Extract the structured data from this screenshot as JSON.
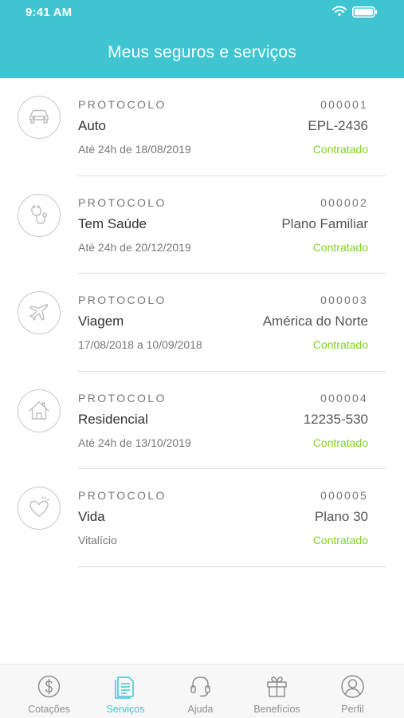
{
  "status_bar": {
    "time": "9:41 AM"
  },
  "header": {
    "title": "Meus seguros e serviços"
  },
  "colors": {
    "accent": "#3ec5d1",
    "status_green": "#7ed321",
    "icon_gray": "#8e8e8e"
  },
  "items": [
    {
      "icon": "car-icon",
      "protocol_label": "PROTOCOLO",
      "protocol_number": "000001",
      "name": "Auto",
      "detail": "EPL-2436",
      "date": "Até 24h de 18/08/2019",
      "status": "Contratado"
    },
    {
      "icon": "stethoscope-icon",
      "protocol_label": "PROTOCOLO",
      "protocol_number": "000002",
      "name": "Tem Saúde",
      "detail": "Plano Familiar",
      "date": "Até 24h de 20/12/2019",
      "status": "Contratado"
    },
    {
      "icon": "airplane-icon",
      "protocol_label": "PROTOCOLO",
      "protocol_number": "000003",
      "name": "Viagem",
      "detail": "América do Norte",
      "date": "17/08/2018 a 10/09/2018",
      "status": "Contratado"
    },
    {
      "icon": "house-icon",
      "protocol_label": "PROTOCOLO",
      "protocol_number": "000004",
      "name": "Residencial",
      "detail": "12235-530",
      "date": "Até 24h de 13/10/2019",
      "status": "Contratado"
    },
    {
      "icon": "heart-icon",
      "protocol_label": "PROTOCOLO",
      "protocol_number": "000005",
      "name": "Vida",
      "detail": "Plano 30",
      "date": "Vitalício",
      "status": "Contratado"
    }
  ],
  "tabbar": {
    "tabs": [
      {
        "label": "Cotações",
        "icon": "dollar-coin-icon",
        "active": false
      },
      {
        "label": "Serviços",
        "icon": "document-icon",
        "active": true
      },
      {
        "label": "Ajuda",
        "icon": "headset-icon",
        "active": false
      },
      {
        "label": "Benefícios",
        "icon": "gift-icon",
        "active": false
      },
      {
        "label": "Perfil",
        "icon": "user-icon",
        "active": false
      }
    ]
  }
}
